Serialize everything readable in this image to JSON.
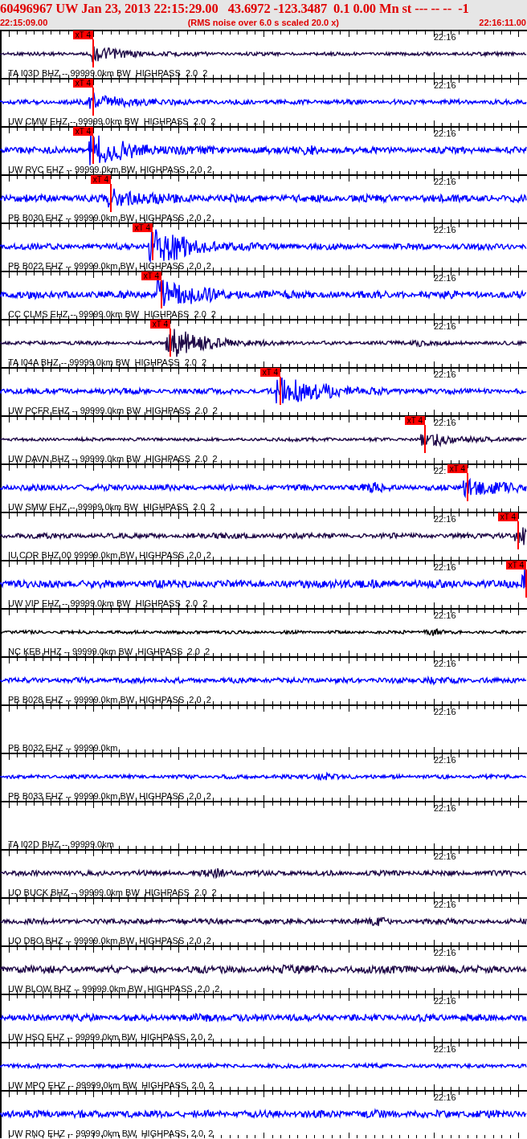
{
  "header": {
    "title": "60496967 UW Jan 23, 2013 22:15:29.00   43.6972 -123.3487  0.1 0.00 Mn st --- -- --  -1",
    "start_time": "22:15:09.00",
    "note": "(RMS noise over 6.0 s scaled 20.0 x)",
    "end_time": "22:16:11.00"
  },
  "traces": [
    {
      "label": "TA I03D BHZ -- 99999.0km BW  HIGHPASS  2.0  2",
      "time_label": "22:16",
      "color": "#200a48",
      "pick": {
        "label": "xT 4"
      }
    },
    {
      "label": "UW CMW EHZ -- 99999.0km BW  HIGHPASS  2.0  2",
      "time_label": "22:16",
      "color": "#0000ff",
      "pick": {
        "label": "xT 4"
      }
    },
    {
      "label": "UW RVC EHZ -- 99999.0km BW  HIGHPASS  2.0  2",
      "time_label": "22:16",
      "color": "#0000ff",
      "pick": {
        "label": "xT 4"
      }
    },
    {
      "label": "PB B030 EHZ -- 99999.0km BW  HIGHPASS  2.0  2",
      "time_label": "22:16",
      "color": "#0000ff",
      "pick": {
        "label": "xT 4"
      }
    },
    {
      "label": "PB B022 EHZ -- 99999.0km BW  HIGHPASS  2.0  2",
      "time_label": "22:16",
      "color": "#0000ff",
      "pick": {
        "label": "xT 4"
      }
    },
    {
      "label": "CC CLMS EHZ -- 99999.0km BW  HIGHPASS  2.0  2",
      "time_label": "22:16",
      "color": "#0000ff",
      "pick": {
        "label": "xT 4"
      }
    },
    {
      "label": "TA I04A BHZ -- 99999.0km BW  HIGHPASS  2.0  2",
      "time_label": "22:16",
      "color": "#200a48",
      "pick": {
        "label": "xT 4"
      }
    },
    {
      "label": "UW PCFR EHZ -- 99999.0km BW  HIGHPASS  2.0  2",
      "time_label": "22:16",
      "color": "#0000ff",
      "pick": {
        "label": "xT 4"
      }
    },
    {
      "label": "UW DAVN BHZ -- 99999.0km BW  HIGHPASS  2.0  2",
      "time_label": "22:16",
      "color": "#200a48",
      "pick": {
        "label": "xT 4"
      }
    },
    {
      "label": "UW SMW EHZ -- 99999.0km BW  HIGHPASS  2.0  2",
      "time_label": "22:",
      "color": "#0000ff",
      "pick": {
        "label": "xT 4"
      }
    },
    {
      "label": "IU COR BHZ 00 99999.0km BW  HIGHPASS  2.0  2",
      "time_label": "22:16",
      "color": "#200a48",
      "pick": {
        "label": "xT 4"
      }
    },
    {
      "label": "UW VIP EHZ -- 99999.0km BW  HIGHPASS  2.0  2",
      "time_label": "22:16",
      "color": "#0000ff",
      "pick": {
        "label": "xT 4"
      }
    },
    {
      "label": "NC KEB HHZ -- 99999.0km BW  HIGHPASS  2.0  2",
      "time_label": "22:16",
      "color": "#000000"
    },
    {
      "label": "PB B028 EHZ -- 99999.0km BW  HIGHPASS  2.0  2",
      "time_label": "22:16",
      "color": "#0000ff"
    },
    {
      "label": "PB B032 EHZ -- 99999.0km",
      "time_label": "22:16"
    },
    {
      "label": "PB B033 EHZ -- 99999.0km BW  HIGHPASS  2.0  2",
      "time_label": "22:16",
      "color": "#0000ff"
    },
    {
      "label": "TA I02D BHZ -- 99999.0km",
      "time_label": "22:16"
    },
    {
      "label": "UO BUCK BHZ -- 99999.0km BW  HIGHPASS  2.0  2",
      "time_label": "22:16",
      "color": "#200a48"
    },
    {
      "label": "UO DBO BHZ -- 99999.0km BW  HIGHPASS  2.0  2",
      "time_label": "22:16",
      "color": "#200a48"
    },
    {
      "label": "UW BLOW BHZ -- 99999.0km BW  HIGHPASS  2.0  2",
      "time_label": "22:16",
      "color": "#200a48"
    },
    {
      "label": "UW HSO EHZ -- 99999.0km BW  HIGHPASS  2.0  2",
      "time_label": "22:16",
      "color": "#0000ff"
    },
    {
      "label": "UW MPO EHZ -- 99999.0km BW  HIGHPASS  2.0  2",
      "time_label": "22:16",
      "color": "#0000ff"
    },
    {
      "label": "UW RNO EHZ -- 99999.0km BW  HIGHPASS  2.0  2",
      "time_label": "22:16",
      "color": "#0000ff"
    }
  ]
}
